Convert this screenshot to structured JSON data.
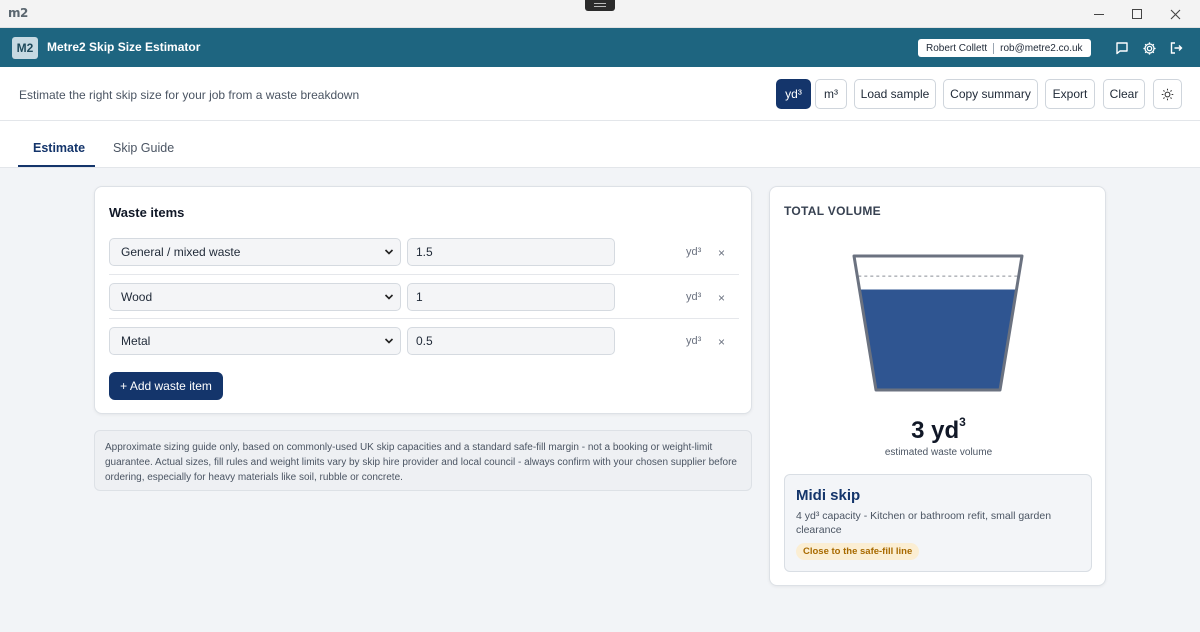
{
  "window": {
    "app_icon_text": "m2"
  },
  "header": {
    "badge": "M2",
    "title": "Metre2 Skip Size Estimator",
    "user_name": "Robert Collett",
    "user_email": "rob@metre2.co.uk"
  },
  "toolbar": {
    "subtitle": "Estimate the right skip size for your job from a waste breakdown",
    "unit_yd": "yd³",
    "unit_m": "m³",
    "active_unit": "yd³",
    "load_sample": "Load sample",
    "copy_summary": "Copy summary",
    "export": "Export",
    "clear": "Clear"
  },
  "tabs": [
    {
      "label": "Estimate",
      "active": true
    },
    {
      "label": "Skip Guide",
      "active": false
    }
  ],
  "waste": {
    "title": "Waste items",
    "items": [
      {
        "type": "General / mixed waste",
        "quantity": "1.5",
        "unit": "yd³",
        "remove": "×"
      },
      {
        "type": "Wood",
        "quantity": "1",
        "unit": "yd³",
        "remove": "×"
      },
      {
        "type": "Metal",
        "quantity": "0.5",
        "unit": "yd³",
        "remove": "×"
      }
    ],
    "add_label": "+ Add waste item"
  },
  "disclaimer": "Approximate sizing guide only, based on commonly-used UK skip capacities and a standard safe-fill margin - not a booking or weight-limit guarantee. Actual sizes, fill rules and weight limits vary by skip hire provider and local council - always confirm with your chosen supplier before ordering, especially for heavy materials like soil, rubble or concrete.",
  "total": {
    "title": "TOTAL VOLUME",
    "value": "3",
    "unit": "yd³",
    "caption": "estimated waste volume",
    "fill_fraction": 0.75,
    "safe_fill_fraction": 0.85,
    "fill_color": "#2f5591",
    "recommendation": {
      "name": "Midi skip",
      "capacity": "4 yd³ capacity - Kitchen or bathroom refit, small garden clearance",
      "badge": "Close to the safe-fill line"
    }
  },
  "colors": {
    "header_bg": "#1e6580",
    "primary": "#14356b",
    "badge_bg": "#fbeed3",
    "badge_text": "#a86a00"
  }
}
